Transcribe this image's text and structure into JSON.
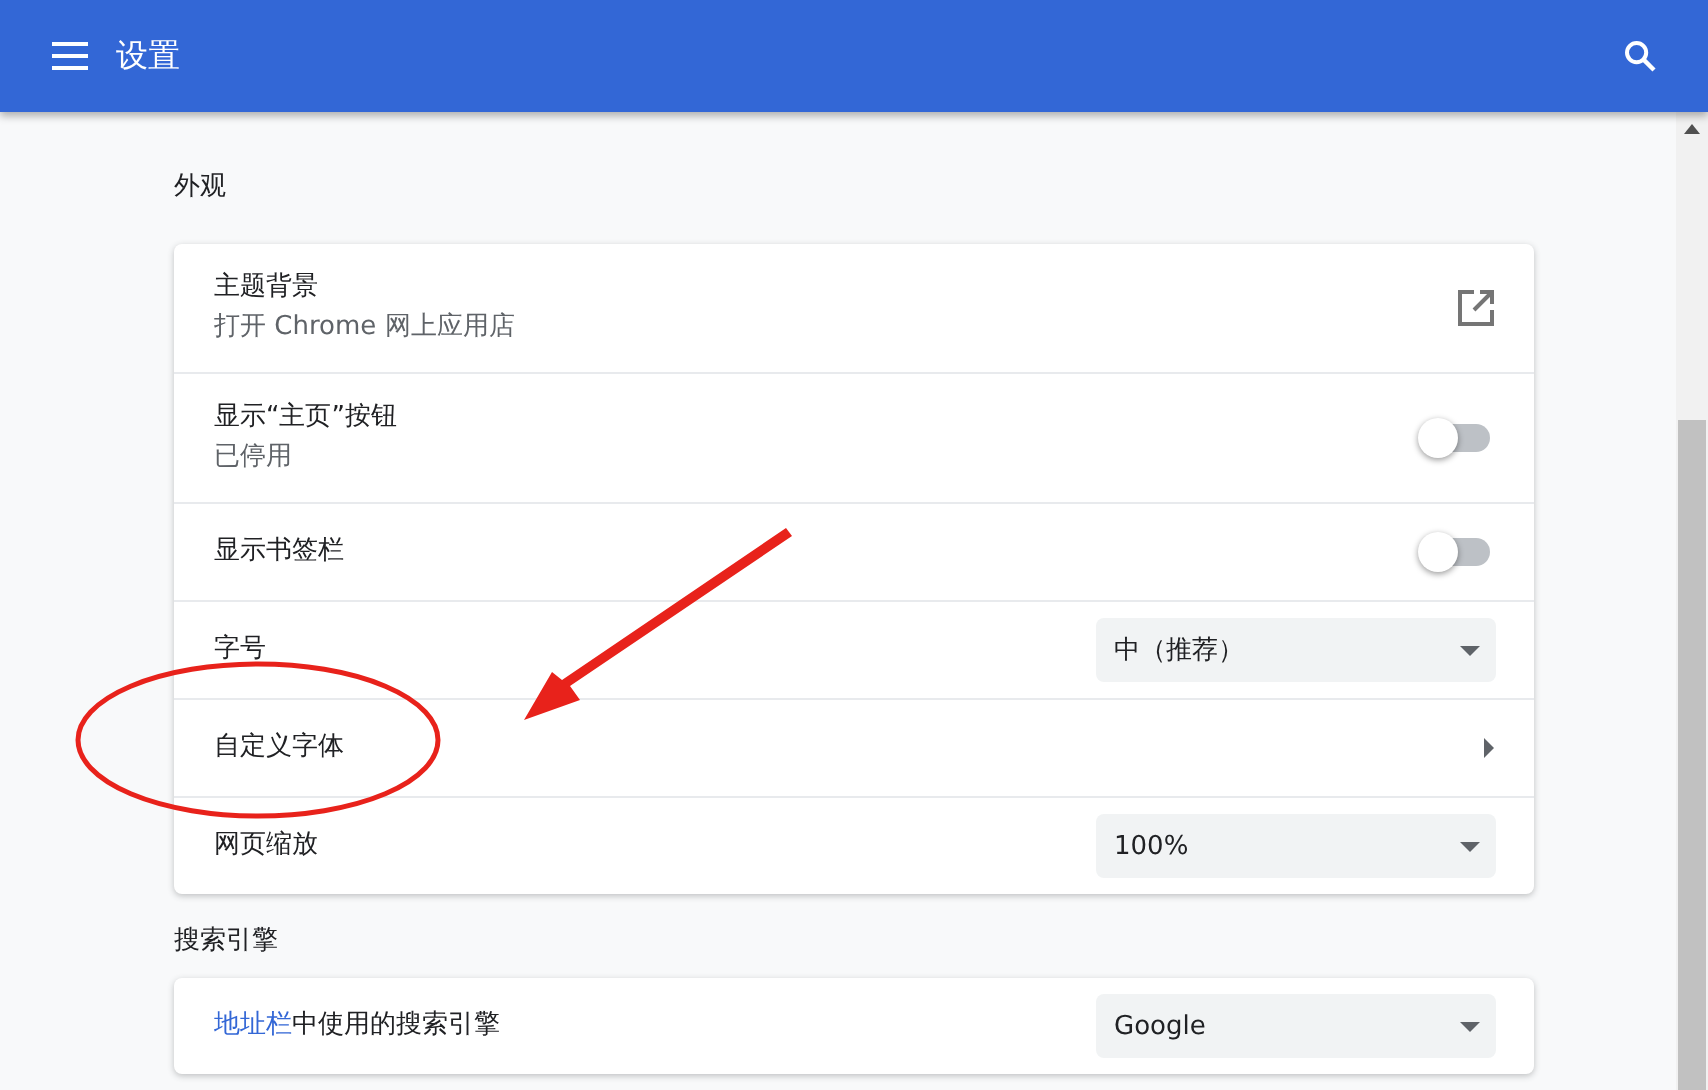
{
  "toolbar": {
    "title": "设置"
  },
  "sections": [
    {
      "title": "外观",
      "rows": [
        {
          "kind": "link",
          "label": "主题背景",
          "sublabel": "打开 Chrome 网上应用店"
        },
        {
          "kind": "toggle",
          "label": "显示“主页”按钮",
          "sublabel": "已停用",
          "on": false
        },
        {
          "kind": "toggle",
          "label": "显示书签栏",
          "on": false
        },
        {
          "kind": "select",
          "label": "字号",
          "value": "中（推荐）"
        },
        {
          "kind": "submenu",
          "label": "自定义字体"
        },
        {
          "kind": "select",
          "label": "网页缩放",
          "value": "100%"
        }
      ]
    },
    {
      "title": "搜索引擎",
      "rows": [
        {
          "kind": "select",
          "label_link": "地址栏",
          "label": "中使用的搜索引擎",
          "value": "Google"
        }
      ]
    }
  ]
}
